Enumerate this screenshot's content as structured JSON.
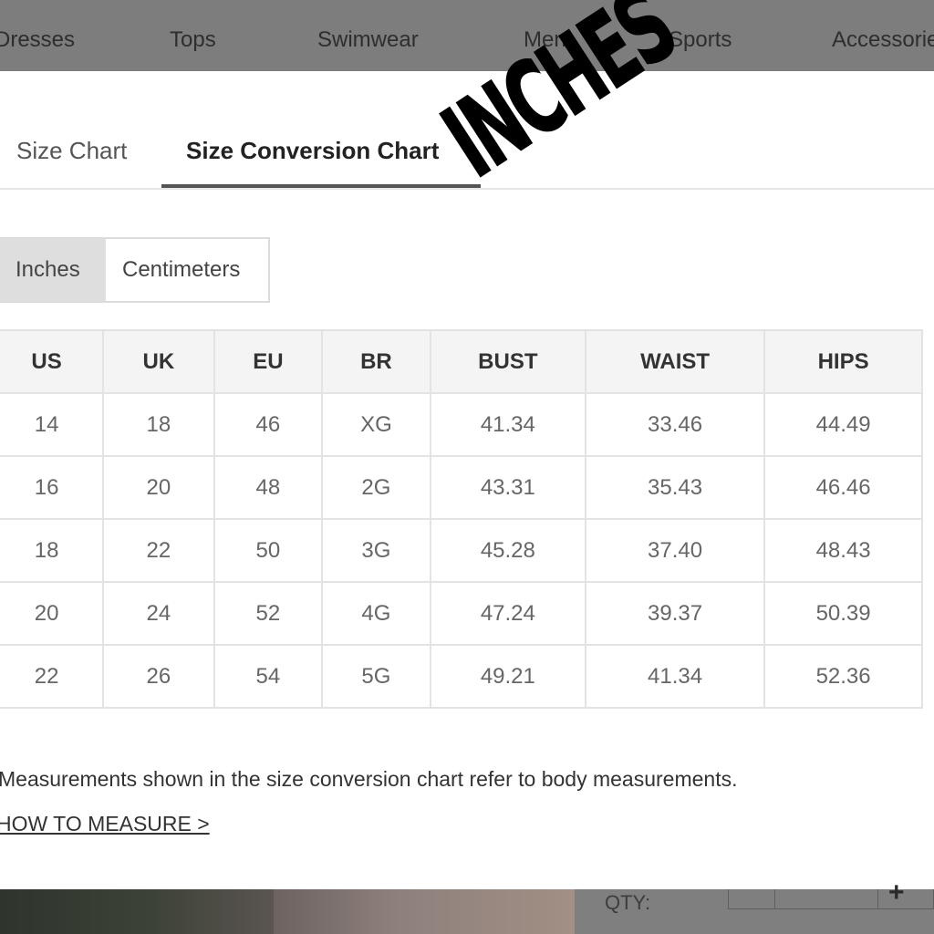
{
  "nav": {
    "items": [
      "Dresses",
      "Tops",
      "Swimwear",
      "Men",
      "Sports",
      "Accessories"
    ]
  },
  "tabs": {
    "size_chart": "Size Chart",
    "conversion_chart": "Size Conversion Chart",
    "active": "Size Conversion Chart"
  },
  "units": {
    "inches": "Inches",
    "centimeters": "Centimeters",
    "selected": "Inches"
  },
  "table": {
    "headers": [
      "US",
      "UK",
      "EU",
      "BR",
      "BUST",
      "WAIST",
      "HIPS"
    ],
    "rows": [
      [
        "14",
        "18",
        "46",
        "XG",
        "41.34",
        "33.46",
        "44.49"
      ],
      [
        "16",
        "20",
        "48",
        "2G",
        "43.31",
        "35.43",
        "46.46"
      ],
      [
        "18",
        "22",
        "50",
        "3G",
        "45.28",
        "37.40",
        "48.43"
      ],
      [
        "20",
        "24",
        "52",
        "4G",
        "47.24",
        "39.37",
        "50.39"
      ],
      [
        "22",
        "26",
        "54",
        "5G",
        "49.21",
        "41.34",
        "52.36"
      ]
    ]
  },
  "note": "Measurements shown in the size conversion chart refer to body measurements.",
  "how_to_measure": "HOW TO MEASURE >",
  "overlay": "INCHES",
  "background": {
    "qty_label": "QTY:",
    "plus": "+"
  },
  "colors": {
    "active_unit_bg": "#dedede",
    "tab_underline": "#555555",
    "header_bg": "#f4f4f4",
    "dim_overlay": "#7d7d7d"
  }
}
